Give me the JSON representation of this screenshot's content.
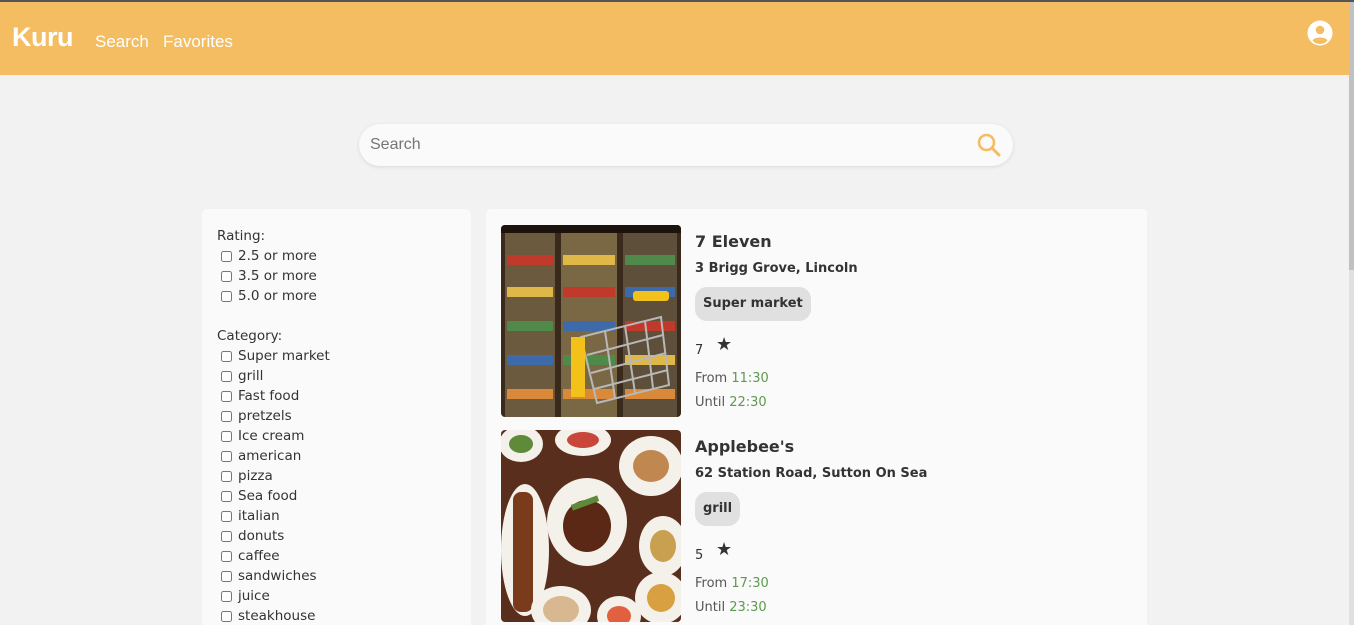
{
  "nav": {
    "brand": "Kuru",
    "links": [
      "Search",
      "Favorites"
    ],
    "user_icon": "account-circle-icon"
  },
  "search": {
    "placeholder": "Search",
    "value": "",
    "icon": "search-icon"
  },
  "filters": {
    "rating_label": "Rating:",
    "ratings": [
      "2.5 or more",
      "3.5 or more",
      "5.0 or more"
    ],
    "category_label": "Category:",
    "categories": [
      "Super market",
      "grill",
      "Fast food",
      "pretzels",
      "Ice cream",
      "american",
      "pizza",
      "Sea food",
      "italian",
      "donuts",
      "caffee",
      "sandwiches",
      "juice",
      "steakhouse"
    ]
  },
  "results": [
    {
      "name": "7 Eleven",
      "address": "3 Brigg Grove, Lincoln",
      "category": "Super market",
      "rating": "7",
      "from_label": "From",
      "from": "11:30",
      "until_label": "Until",
      "until": "22:30"
    },
    {
      "name": "Applebee's",
      "address": "62 Station Road, Sutton On Sea",
      "category": "grill",
      "rating": "5",
      "from_label": "From",
      "from": "17:30",
      "until_label": "Until",
      "until": "23:30"
    }
  ],
  "colors": {
    "nav": "#f4bd61",
    "accent_time": "#5e9950",
    "background": "#f2f2f2"
  }
}
